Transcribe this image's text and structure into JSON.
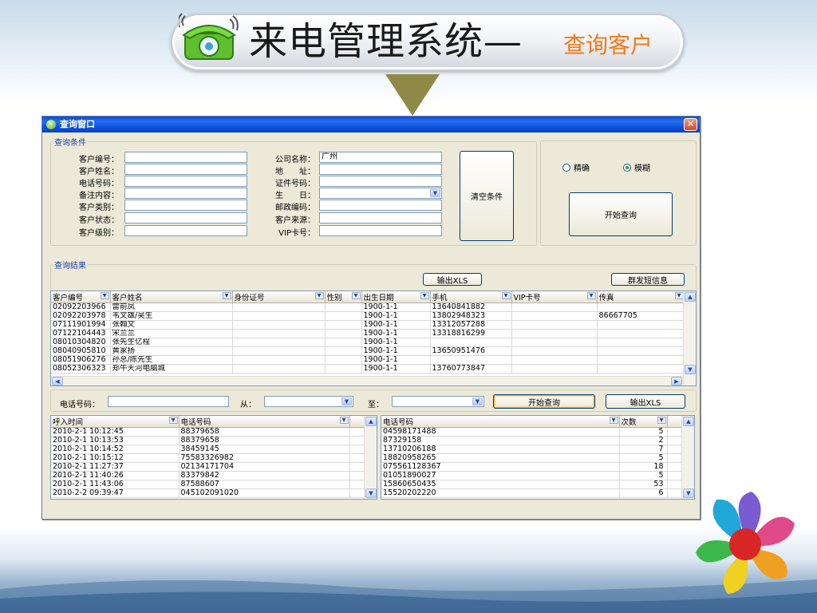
{
  "slide": {
    "title_main": "来电管理系统—",
    "title_sub": "查询客户"
  },
  "window": {
    "title": "查询窗口",
    "close_glyph": "✕"
  },
  "query": {
    "legend": "查询条件",
    "left_fields": [
      {
        "label": "客户编号：",
        "value": ""
      },
      {
        "label": "客户姓名：",
        "value": ""
      },
      {
        "label": "电话号码：",
        "value": ""
      },
      {
        "label": "备注内容：",
        "value": ""
      },
      {
        "label": "客户类别：",
        "value": ""
      },
      {
        "label": "客户状态：",
        "value": ""
      },
      {
        "label": "客户级别：",
        "value": ""
      }
    ],
    "right_fields": [
      {
        "label": "公司名称：",
        "value": "广州"
      },
      {
        "label": "地　　址：",
        "value": ""
      },
      {
        "label": "证件号码：",
        "value": ""
      },
      {
        "label": "生　　日：",
        "value": ""
      },
      {
        "label": "邮政编码：",
        "value": ""
      },
      {
        "label": "客户来源：",
        "value": ""
      },
      {
        "label": "VIP卡号：",
        "value": ""
      }
    ],
    "clear_button": "清空条件",
    "mode_exact": "精确",
    "mode_fuzzy": "模糊",
    "mode_selected": "模糊",
    "start_button": "开始查询"
  },
  "results": {
    "legend": "查询结果",
    "export_button": "输出XLS",
    "sms_button": "群发短信息",
    "columns": [
      "客户编号",
      "客户姓名",
      "身份证号",
      "性别",
      "出生日期",
      "手机",
      "VIP卡号",
      "传真"
    ],
    "rows": [
      [
        "02092203966",
        "雷前凤",
        "",
        "",
        "1900-1-1",
        "13640841882",
        "",
        ""
      ],
      [
        "02092203978",
        "韦文雄/吴生",
        "",
        "",
        "1900-1-1",
        "13802948323",
        "",
        "86667705"
      ],
      [
        "07111901994",
        "张翰文",
        "",
        "",
        "1900-1-1",
        "13312057288",
        "",
        ""
      ],
      [
        "07122104443",
        "宋兰兰",
        "",
        "",
        "1900-1-1",
        "13318816299",
        "",
        ""
      ],
      [
        "08010304820",
        "张先生亿程",
        "",
        "",
        "1900-1-1",
        "",
        "",
        ""
      ],
      [
        "08040905810",
        "黄家扬",
        "",
        "",
        "1900-1-1",
        "13650951476",
        "",
        ""
      ],
      [
        "08051906276",
        "孙总/陈先生",
        "",
        "",
        "1900-1-1",
        "",
        "",
        ""
      ],
      [
        "08052306323",
        "郑牛天河电脑城",
        "",
        "",
        "1900-1-1",
        "13760773847",
        "",
        ""
      ]
    ]
  },
  "calls": {
    "phone_label": "电话号码：",
    "phone_value": "",
    "from_label": "从：",
    "to_label": "至：",
    "start_button": "开始查询",
    "export_button": "输出XLS",
    "log_columns": [
      "呼入时间",
      "电话号码"
    ],
    "log_rows": [
      [
        "2010-2-1 10:12:45",
        "88379658"
      ],
      [
        "2010-2-1 10:13:53",
        "88379658"
      ],
      [
        "2010-2-1 10:14:52",
        "38459145"
      ],
      [
        "2010-2-1 10:15:12",
        "75583326982"
      ],
      [
        "2010-2-1 11:27:37",
        "02134171704"
      ],
      [
        "2010-2-1 11:40:26",
        "83379842"
      ],
      [
        "2010-2-1 11:43:06",
        "87588607"
      ],
      [
        "2010-2-2 09:39:47",
        "045102091020"
      ]
    ],
    "count_columns": [
      "电话号码",
      "次数"
    ],
    "count_rows": [
      [
        "04598171488",
        "5"
      ],
      [
        "87329158",
        "2"
      ],
      [
        "13710206188",
        "7"
      ],
      [
        "18820958265",
        "5"
      ],
      [
        "075561128367",
        "18"
      ],
      [
        "01051890027",
        "5"
      ],
      [
        "15860650435",
        "53"
      ],
      [
        "15520202220",
        "6"
      ]
    ]
  },
  "colors": {
    "accent_orange": "#f07a1a",
    "arrow": "#8f8a48",
    "titlebar": "#0a4bd1",
    "legend_text": "#1c3fa8"
  }
}
